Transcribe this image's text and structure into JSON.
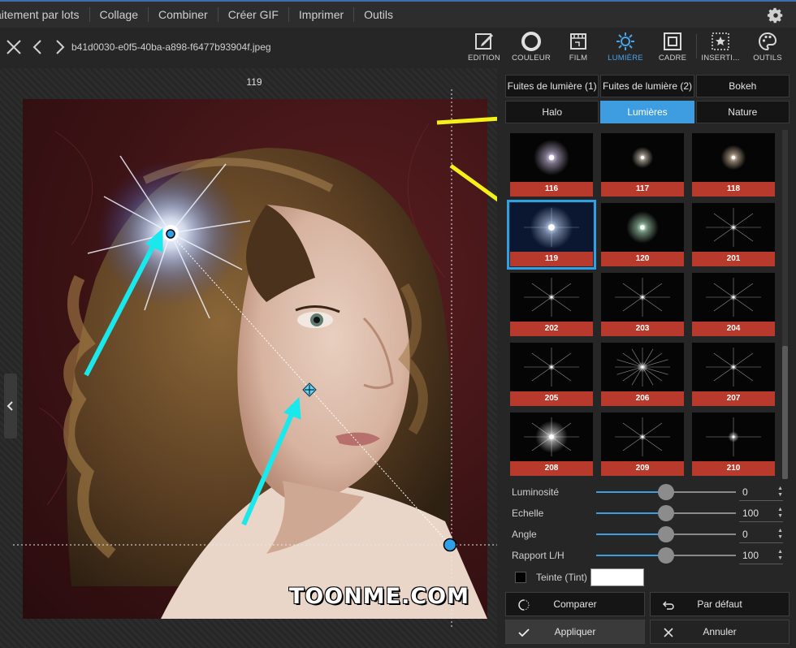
{
  "menu": {
    "items": [
      "aitement par lots",
      "Collage",
      "Combiner",
      "Créer GIF",
      "Imprimer",
      "Outils"
    ]
  },
  "file": {
    "name": "b41d0030-e0f5-40ba-a898-f6477b93904f.jpeg"
  },
  "tools": [
    {
      "label": "EDITION",
      "icon": "edit-icon"
    },
    {
      "label": "COULEUR",
      "icon": "color-circle-icon"
    },
    {
      "label": "FILM",
      "icon": "film-icon"
    },
    {
      "label": "LUMIÈRE",
      "icon": "sun-icon",
      "active": true
    },
    {
      "label": "CADRE",
      "icon": "frame-icon"
    },
    {
      "label": "INSERTI...",
      "icon": "insert-icon"
    },
    {
      "label": "OUTILS",
      "icon": "palette-icon"
    }
  ],
  "canvas": {
    "light_number": "119",
    "watermark": "TOONME.COM"
  },
  "tabs": {
    "row1": [
      "Fuites de lumière (1)",
      "Fuites de lumière (2)",
      "Bokeh"
    ],
    "row2": [
      "Halo",
      "Lumières",
      "Nature"
    ],
    "selected": "Lumières"
  },
  "thumbnails": [
    {
      "label": "116",
      "style": "glow-purple"
    },
    {
      "label": "117",
      "style": "glow-small"
    },
    {
      "label": "118",
      "style": "glow-warm"
    },
    {
      "label": "119",
      "style": "glow-blue",
      "selected": true
    },
    {
      "label": "120",
      "style": "glow-green"
    },
    {
      "label": "201",
      "style": "star-thin"
    },
    {
      "label": "202",
      "style": "star-thin"
    },
    {
      "label": "203",
      "style": "star-thin"
    },
    {
      "label": "204",
      "style": "star-thin"
    },
    {
      "label": "205",
      "style": "star-thin"
    },
    {
      "label": "206",
      "style": "star-burst"
    },
    {
      "label": "207",
      "style": "star-thin"
    },
    {
      "label": "208",
      "style": "glow-bright"
    },
    {
      "label": "209",
      "style": "star-thin"
    },
    {
      "label": "210",
      "style": "star-cross"
    }
  ],
  "sliders": [
    {
      "label": "Luminosité",
      "value": "0",
      "fraction": 0.5
    },
    {
      "label": "Echelle",
      "value": "100",
      "fraction": 0.5
    },
    {
      "label": "Angle",
      "value": "0",
      "fraction": 0.5
    },
    {
      "label": "Rapport L/H",
      "value": "100",
      "fraction": 0.5
    }
  ],
  "tint": {
    "label": "Teinte (Tint)",
    "checked": false,
    "color": "#ffffff"
  },
  "buttons": {
    "compare": "Comparer",
    "default": "Par défaut",
    "apply": "Appliquer",
    "cancel": "Annuler"
  },
  "colors": {
    "accent": "#3d9de0",
    "label_bg": "#b83a2c",
    "annotation_yellow": "#f5f01a",
    "annotation_cyan": "#19e8ec"
  }
}
